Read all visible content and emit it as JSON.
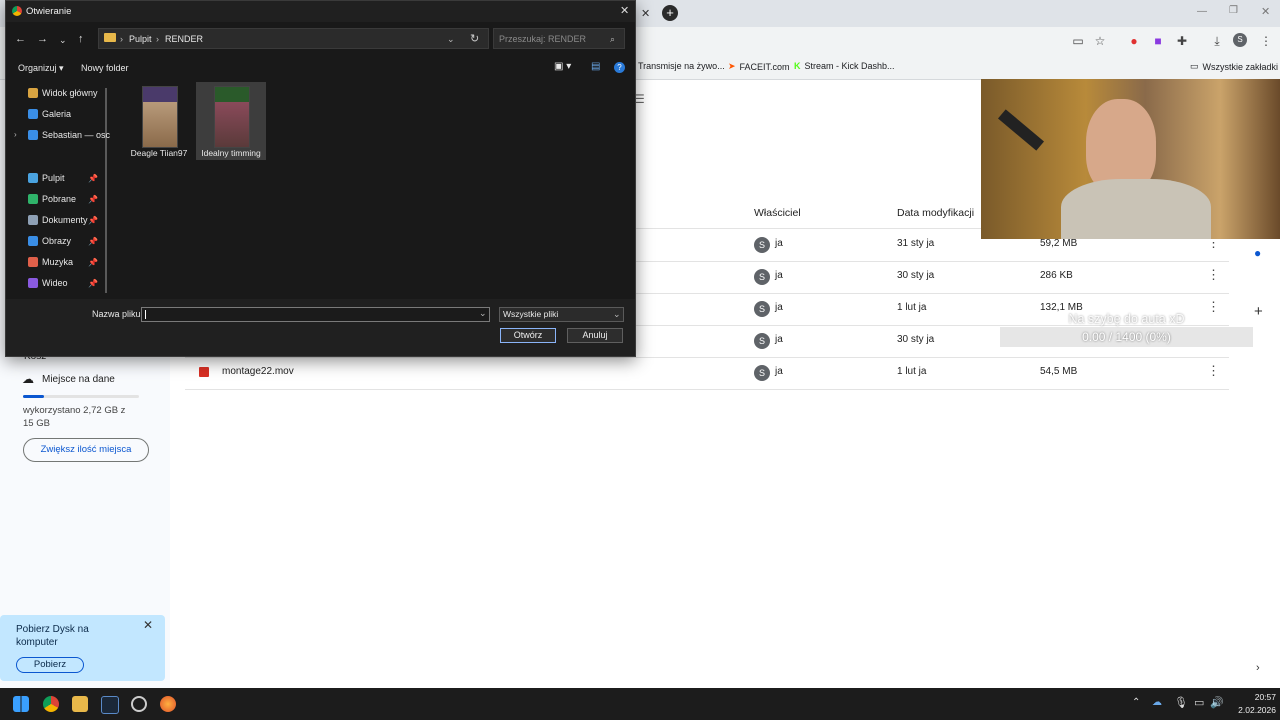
{
  "browser": {
    "bookmarks": [
      "Transmisje na żywo...",
      "FACEIT.com",
      "Stream - Kick Dashb...",
      "Wszystkie zakładki"
    ],
    "profile_initial": "S"
  },
  "drive": {
    "sidebar": {
      "trash": "Kosz",
      "storage_label": "Miejsce na dane",
      "storage_used_text": "wykorzystano 2,72 GB z 15 GB",
      "storage_fraction": 0.18,
      "upgrade_button": "Zwiększ ilość miejsca",
      "promo_text": "Pobierz Dysk na komputer",
      "promo_button": "Pobierz"
    },
    "columns": {
      "owner": "Właściciel",
      "modified": "Data modyfikacji"
    },
    "rows": [
      {
        "name": "",
        "owner_initial": "S",
        "owner": "ja",
        "date": "31 sty ja",
        "size": "59,2 MB"
      },
      {
        "name": "",
        "owner_initial": "S",
        "owner": "ja",
        "date": "30 sty ja",
        "size": "286 KB"
      },
      {
        "name": "",
        "owner_initial": "S",
        "owner": "ja",
        "date": "1 lut ja",
        "size": "132,1 MB"
      },
      {
        "name": "",
        "owner_initial": "S",
        "owner": "ja",
        "date": "30 sty ja",
        "size": ""
      },
      {
        "name": "montage22.mov",
        "owner_initial": "S",
        "owner": "ja",
        "date": "1 lut ja",
        "size": "54,5 MB"
      }
    ]
  },
  "overlay": {
    "goal_title": "Na szybę do auta xD",
    "goal_progress": "0.00 / 1400 (0%)"
  },
  "dialog": {
    "title": "Otwieranie",
    "breadcrumb": [
      "Pulpit",
      "RENDER"
    ],
    "search_placeholder": "Przeszukaj: RENDER",
    "organize": "Organizuj",
    "new_folder": "Nowy folder",
    "nav_items": [
      {
        "label": "Widok główny",
        "color": "#d9a441"
      },
      {
        "label": "Galeria",
        "color": "#3a8ee6"
      },
      {
        "label": "Sebastian — osc",
        "color": "#3a8ee6"
      },
      {
        "label": "Pulpit",
        "color": "#4aa3e0",
        "pinned": true
      },
      {
        "label": "Pobrane",
        "color": "#2fb36a",
        "pinned": true
      },
      {
        "label": "Dokumenty",
        "color": "#8ea0b5",
        "pinned": true
      },
      {
        "label": "Obrazy",
        "color": "#3a8ee6",
        "pinned": true
      },
      {
        "label": "Muzyka",
        "color": "#e0604a",
        "pinned": true
      },
      {
        "label": "Wideo",
        "color": "#8a5ae0",
        "pinned": true
      }
    ],
    "files": [
      {
        "name": "Deagle Tiian97",
        "selected": false
      },
      {
        "name": "Idealny timming",
        "selected": true
      }
    ],
    "filename_label": "Nazwa pliku:",
    "filename_value": "",
    "filter": "Wszystkie pliki",
    "open_button": "Otwórz",
    "cancel_button": "Anuluj"
  },
  "taskbar": {
    "time": "20:57",
    "date": "2.02.2026"
  }
}
